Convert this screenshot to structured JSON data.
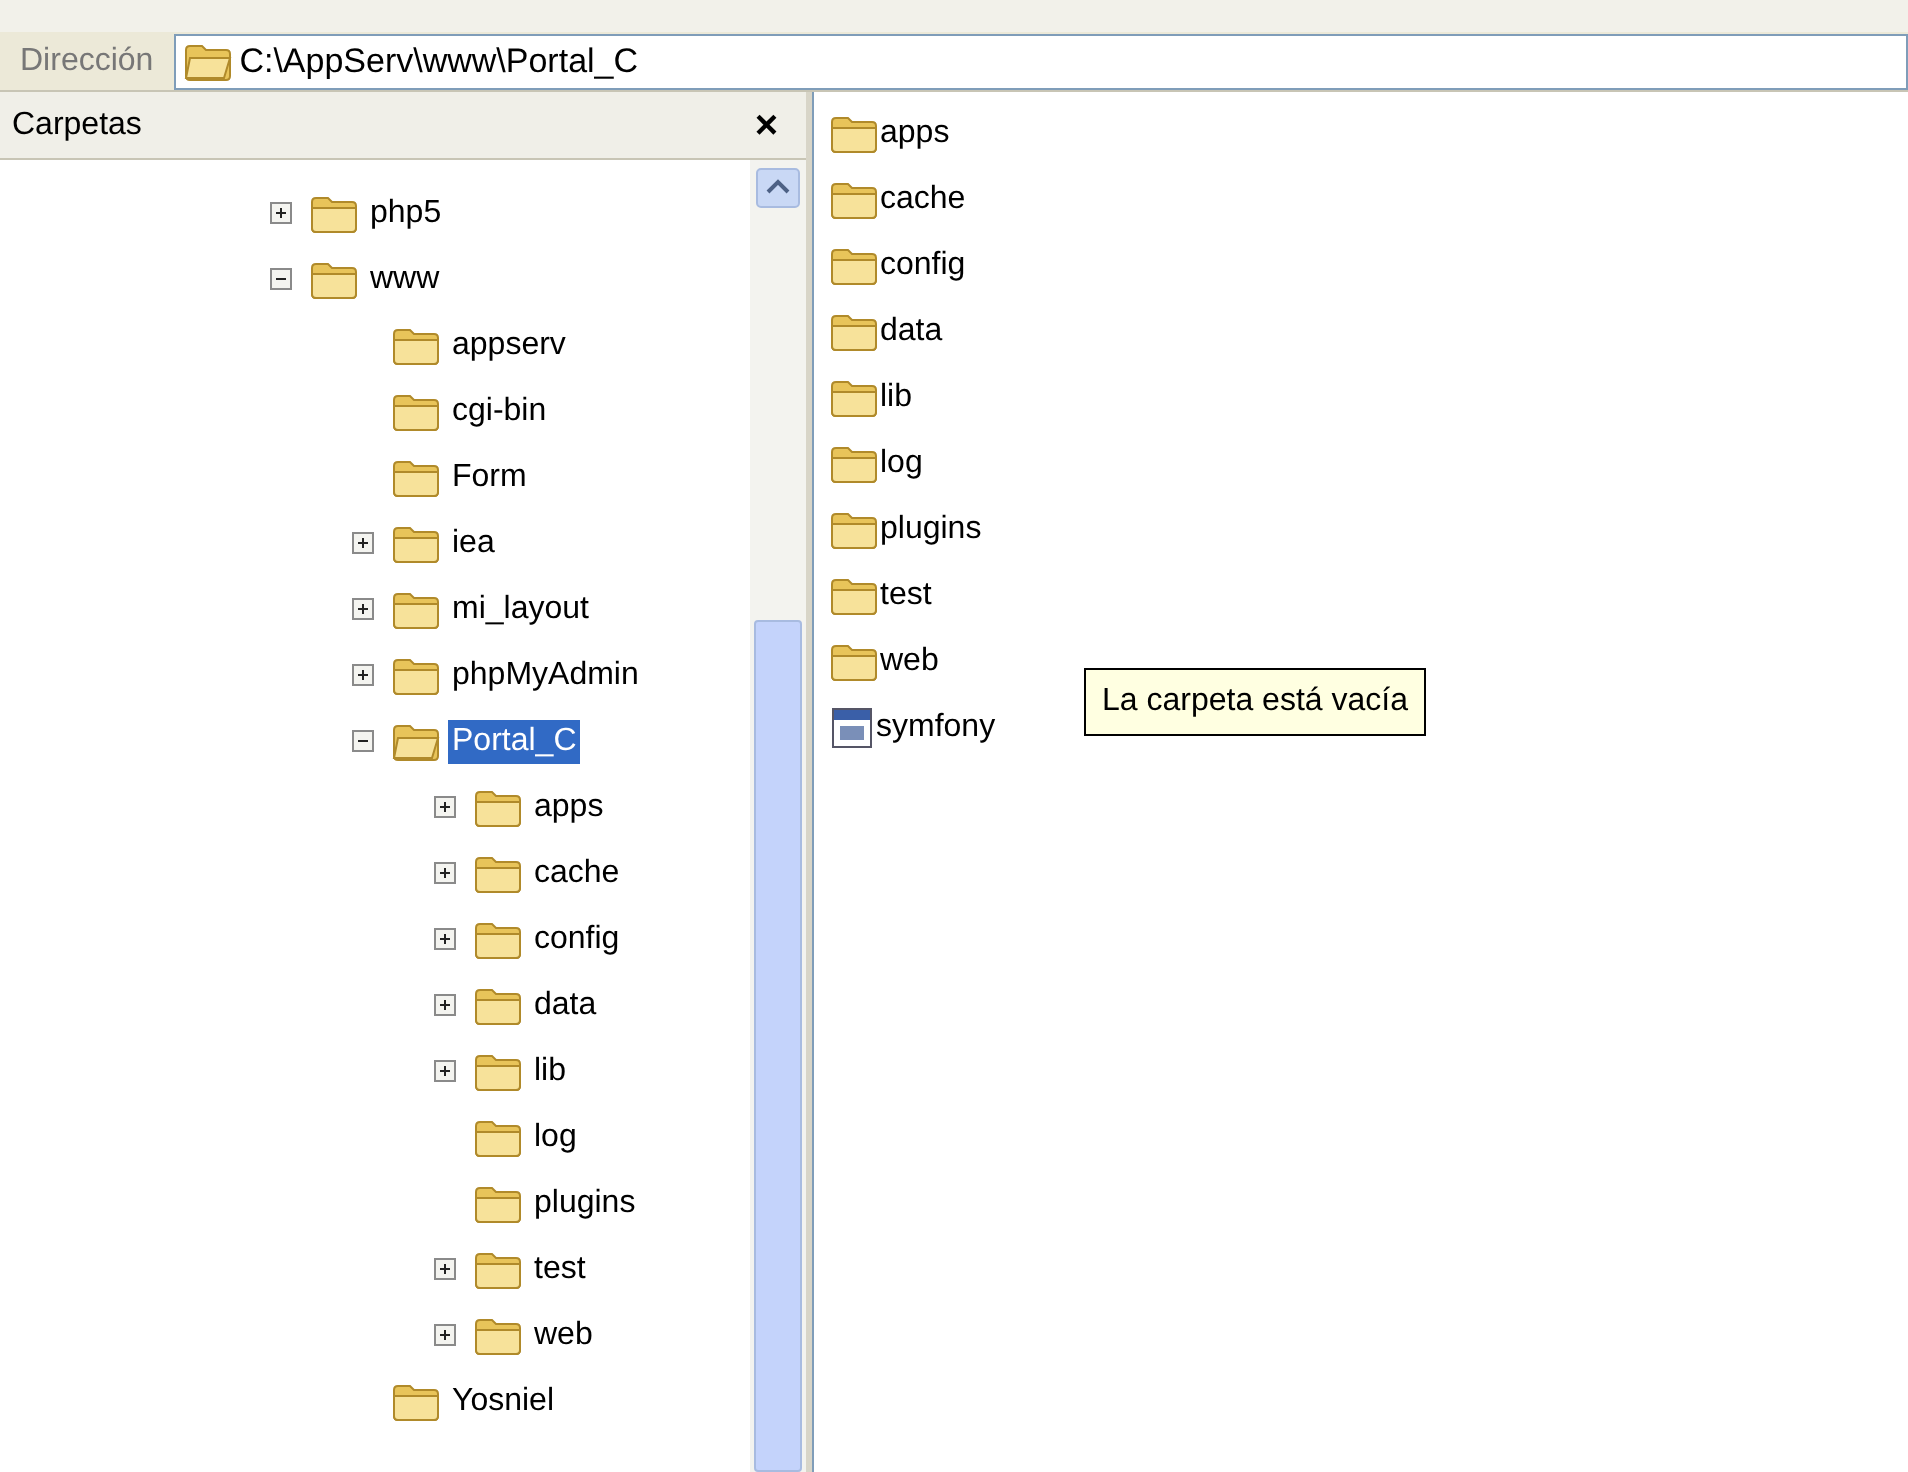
{
  "address_bar": {
    "label": "Dirección",
    "path": "C:\\AppServ\\www\\Portal_C"
  },
  "folders_pane": {
    "title": "Carpetas",
    "close": "×"
  },
  "tree": [
    {
      "name": "php5",
      "has_toggle": true,
      "expanded": false,
      "selected": false
    },
    {
      "name": "www",
      "has_toggle": true,
      "expanded": true,
      "selected": false,
      "children": [
        {
          "name": "appserv",
          "has_toggle": false,
          "expanded": false,
          "selected": false
        },
        {
          "name": "cgi-bin",
          "has_toggle": false,
          "expanded": false,
          "selected": false
        },
        {
          "name": "Form",
          "has_toggle": false,
          "expanded": false,
          "selected": false
        },
        {
          "name": "iea",
          "has_toggle": true,
          "expanded": false,
          "selected": false
        },
        {
          "name": "mi_layout",
          "has_toggle": true,
          "expanded": false,
          "selected": false
        },
        {
          "name": "phpMyAdmin",
          "has_toggle": true,
          "expanded": false,
          "selected": false
        },
        {
          "name": "Portal_C",
          "has_toggle": true,
          "expanded": true,
          "selected": true,
          "children": [
            {
              "name": "apps",
              "has_toggle": true,
              "expanded": false,
              "selected": false
            },
            {
              "name": "cache",
              "has_toggle": true,
              "expanded": false,
              "selected": false
            },
            {
              "name": "config",
              "has_toggle": true,
              "expanded": false,
              "selected": false
            },
            {
              "name": "data",
              "has_toggle": true,
              "expanded": false,
              "selected": false
            },
            {
              "name": "lib",
              "has_toggle": true,
              "expanded": false,
              "selected": false
            },
            {
              "name": "log",
              "has_toggle": false,
              "expanded": false,
              "selected": false
            },
            {
              "name": "plugins",
              "has_toggle": false,
              "expanded": false,
              "selected": false
            },
            {
              "name": "test",
              "has_toggle": true,
              "expanded": false,
              "selected": false
            },
            {
              "name": "web",
              "has_toggle": true,
              "expanded": false,
              "selected": false
            }
          ]
        },
        {
          "name": "Yosniel",
          "has_toggle": false,
          "expanded": false,
          "selected": false
        }
      ]
    }
  ],
  "files": [
    {
      "name": "apps",
      "kind": "folder"
    },
    {
      "name": "cache",
      "kind": "folder"
    },
    {
      "name": "config",
      "kind": "folder"
    },
    {
      "name": "data",
      "kind": "folder"
    },
    {
      "name": "lib",
      "kind": "folder"
    },
    {
      "name": "log",
      "kind": "folder"
    },
    {
      "name": "plugins",
      "kind": "folder"
    },
    {
      "name": "test",
      "kind": "folder"
    },
    {
      "name": "web",
      "kind": "folder"
    },
    {
      "name": "symfony",
      "kind": "script"
    }
  ],
  "tooltip": "La carpeta está vacía"
}
